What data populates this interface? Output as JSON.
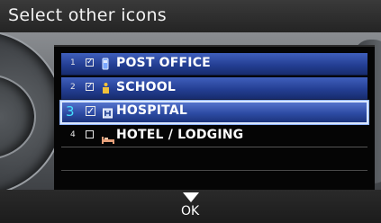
{
  "header": {
    "title": "Select other icons"
  },
  "list": {
    "items": [
      {
        "number": "1",
        "checked": true,
        "icon": "post-office-icon",
        "label": "POST OFFICE"
      },
      {
        "number": "2",
        "checked": true,
        "icon": "school-icon",
        "label": "SCHOOL"
      },
      {
        "number": "3",
        "checked": true,
        "icon": "hospital-icon",
        "label": "HOSPITAL"
      },
      {
        "number": "4",
        "checked": false,
        "icon": "hotel-icon",
        "label": "HOTEL / LODGING"
      }
    ],
    "check_mark": "☑"
  },
  "footer": {
    "ok_label": "OK",
    "ok_icon": "down-arrow-icon"
  },
  "colors": {
    "highlight_number": "#46e2ff",
    "row_blue": "#243f94"
  }
}
